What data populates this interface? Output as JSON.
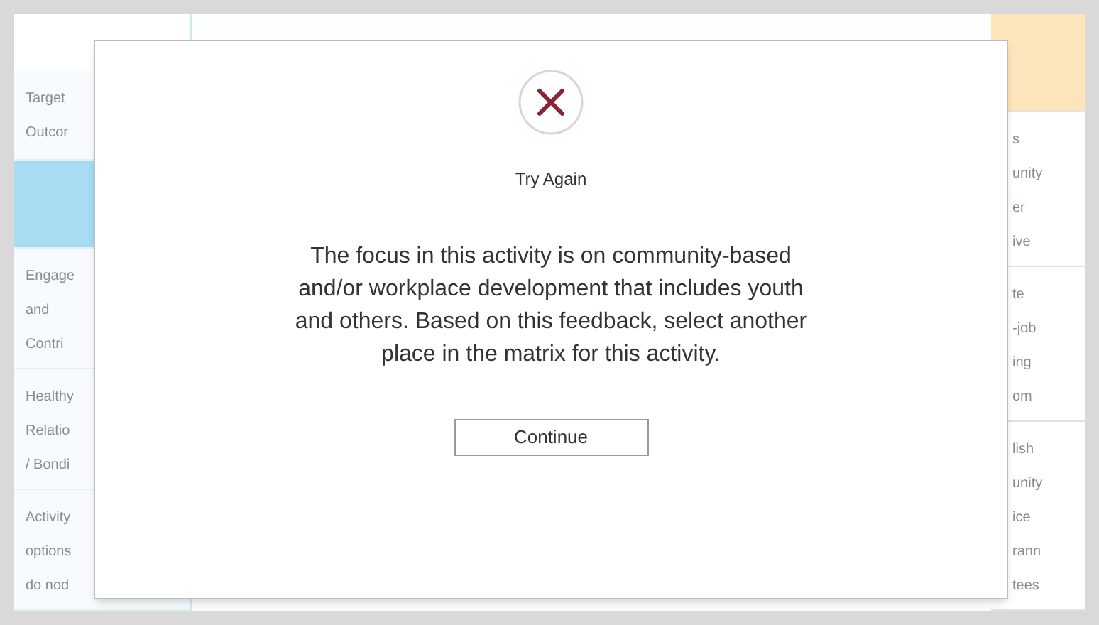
{
  "background": {
    "left_rows": [
      {
        "text": "Target\nOutcor",
        "highlighted": false
      },
      {
        "text": "",
        "highlighted": true
      },
      {
        "text": "Engage\nand\nContri",
        "highlighted": false
      },
      {
        "text": "Healthy\nRelatio\n/ Bondi",
        "highlighted": false
      },
      {
        "text": "Activity\noptions\ndo nod",
        "highlighted": false
      }
    ],
    "right_rows": [
      {
        "text": "",
        "highlighted": true
      },
      {
        "text": "s\nunity\ner\nive",
        "highlighted": false
      },
      {
        "text": "te\n-job\ning\nom",
        "highlighted": false
      },
      {
        "text": "lish\nunity\nice\nrann\ntees",
        "highlighted": false
      }
    ]
  },
  "dialog": {
    "status": "Try Again",
    "message": "The focus in this activity is on community-based and/or workplace development that includes youth and others. Based on this feedback, select another place in the matrix for this activity.",
    "button": "Continue"
  }
}
